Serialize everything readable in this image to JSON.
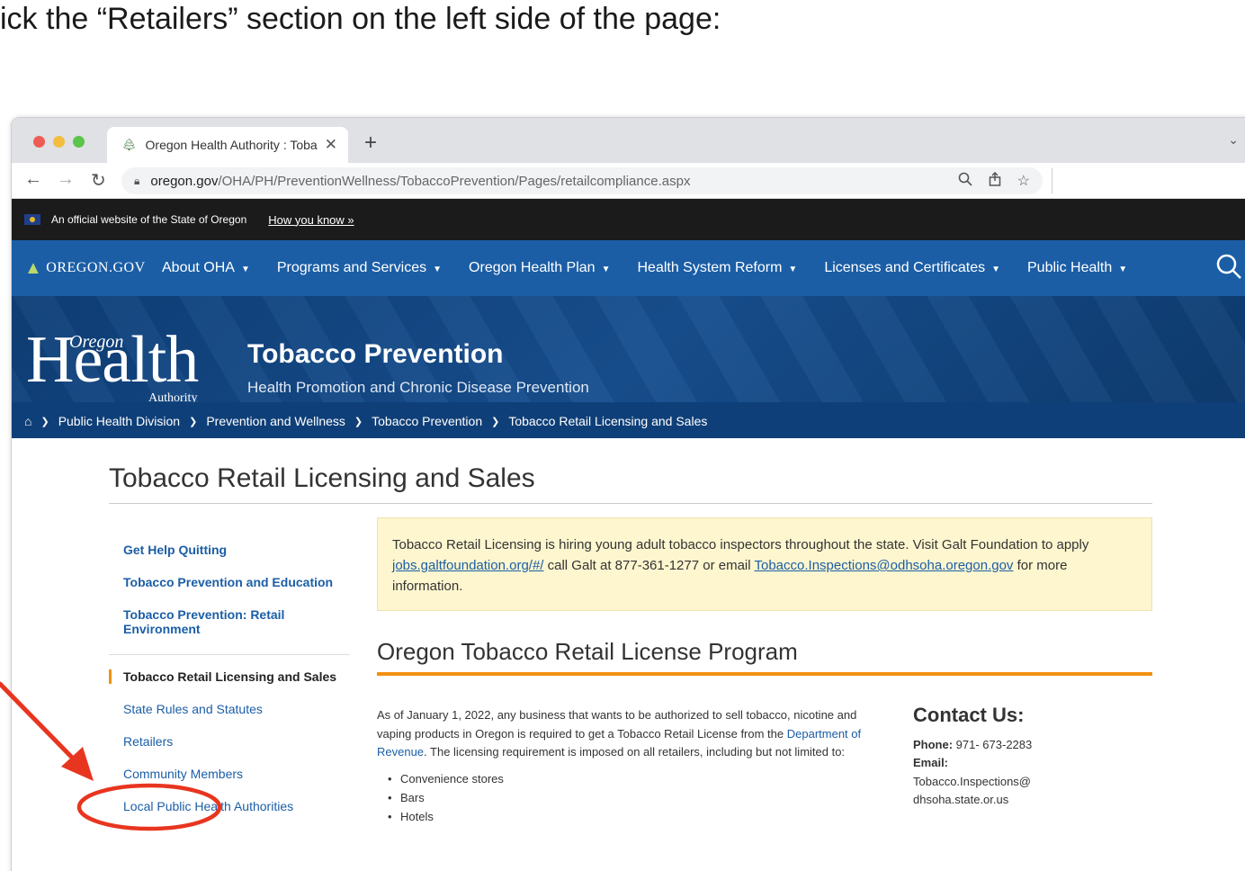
{
  "instruction": "ick the “Retailers” section on the left side of the page:",
  "browser": {
    "tab_title": "Oregon Health Authority : Toba",
    "url_domain": "oregon.gov",
    "url_path": "/OHA/PH/PreventionWellness/TobaccoPrevention/Pages/retailcompliance.aspx"
  },
  "official_banner": {
    "text": "An official website of the State of Oregon",
    "how_link": "How you know »"
  },
  "mainnav": {
    "logo": "OREGON.GOV",
    "items": [
      {
        "label": "About OHA"
      },
      {
        "label": "Programs and Services"
      },
      {
        "label": "Oregon Health Plan"
      },
      {
        "label": "Health System Reform"
      },
      {
        "label": "Licenses and Certificates"
      },
      {
        "label": "Public Health"
      }
    ]
  },
  "banner": {
    "logo_health": "Health",
    "logo_oregon": "Oregon",
    "logo_authority": "Authority",
    "title": "Tobacco Prevention",
    "subtitle": "Health Promotion and Chronic Disease Prevention"
  },
  "breadcrumb": [
    "Public Health Division",
    "Prevention and Wellness",
    "Tobacco Prevention",
    "Tobacco Retail Licensing and Sales"
  ],
  "page_title": "Tobacco Retail Licensing and Sales",
  "sidenav": {
    "top_links": [
      "Get Help Quitting",
      "Tobacco Prevention and Education",
      "Tobacco Prevention: Retail Environment"
    ],
    "active": "Tobacco Retail Licensing and Sales",
    "sub_links": [
      "State Rules and Statutes",
      "Retailers",
      "Community Members",
      "Local Public Health Authorities"
    ]
  },
  "notice": {
    "text1": "Tobacco Retail Licensing is hiring young adult tobacco inspectors throughout the state. Visit Galt Foundation to apply ",
    "link1": "jobs.galtfoundation.org/#/",
    "text2": " call Galt at 877-361-1277 or email ",
    "link2": "Tobacco.Inspections@odhsoha.oregon.gov",
    "text3": " for more information."
  },
  "program": {
    "title": "Oregon Tobacco Retail License Program",
    "body1": "As of January 1, 2022, any business that wants to be authorized to sell tobacco, nicotine and vaping products in Oregon is required to get a Tobacco Retail License from the ",
    "link": "Department of Revenue",
    "body2": ". The licensing requirement is imposed on all retailers, including but not limited to:",
    "bullets": [
      "Convenience stores",
      "Bars",
      "Hotels"
    ]
  },
  "contact": {
    "title": "Contact Us:",
    "phone_label": "Phone:",
    "phone": " 971- 673-2283",
    "email_label": "Email:",
    "email1": "Tobacco.Inspections@",
    "email2": "dhsoha.state.or.us"
  },
  "colors": {
    "nav_blue": "#1b5ea6",
    "accent_orange": "#f29111",
    "annotation_red": "#e8351f"
  }
}
